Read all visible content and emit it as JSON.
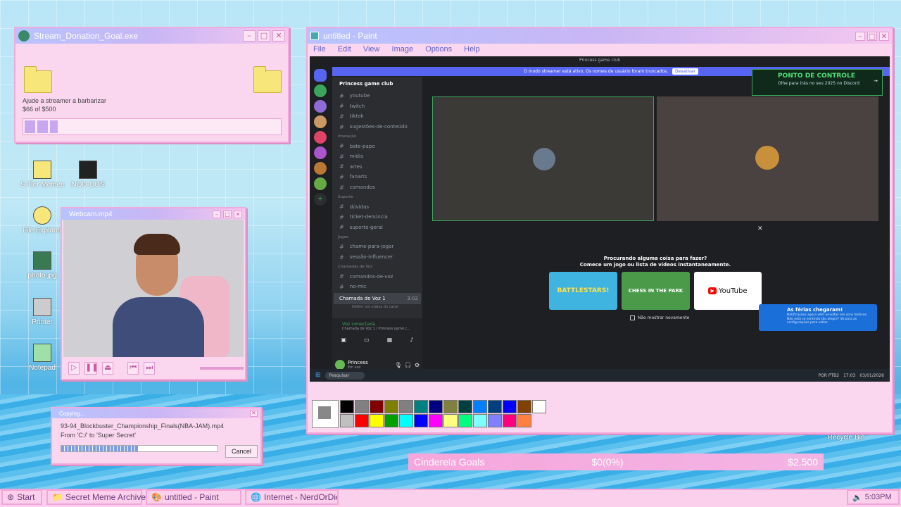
{
  "donation": {
    "title": "Stream_Donation_Goal.exe",
    "text": "Ajude a streamer a barbarizar",
    "amount": "$66 of $500",
    "progress": 0.13
  },
  "desktop_icons": [
    {
      "label": "S-Tier Memes"
    },
    {
      "label": "NOD-DOS"
    },
    {
      "label": "File Explorer"
    },
    {
      "label": "photo.jpg"
    },
    {
      "label": "Printer"
    },
    {
      "label": "Notepad"
    },
    {
      "label": "Recycle Bin"
    }
  ],
  "webcam": {
    "title": "Webcam.mp4"
  },
  "copying": {
    "title": "Copying...",
    "file": "93-94_Blockbuster_Championship_Finals(NBA-JAM).mp4",
    "path": "From 'C:/' to 'Super Secret'",
    "cancel": "Cancel",
    "progress": 0.49
  },
  "paint": {
    "title": "untitled - Paint",
    "menu": [
      "File",
      "Edit",
      "View",
      "Image",
      "Options",
      "Help"
    ],
    "palette": [
      "#000000",
      "#808080",
      "#800000",
      "#808000",
      "#808080",
      "#008080",
      "#000080",
      "#808040",
      "#004040",
      "#0080ff",
      "#004080",
      "#0000ff",
      "#804000",
      "#ffffff",
      "#c0c0c0",
      "#ff0000",
      "#ffff00",
      "#00a000",
      "#00ffff",
      "#0000ff",
      "#ff00ff",
      "#ffff80",
      "#00ff80",
      "#80ffff",
      "#8080ff",
      "#ff0080",
      "#ff8040"
    ]
  },
  "discord": {
    "window_title": "Princess game club",
    "banner": "O modo streamer está ativo. Os nomes de usuário foram truncados.",
    "banner_button": "Desativar",
    "server": "Princess game club",
    "channels_top": [
      "youtube",
      "twitch",
      "tiktok",
      "sugestões-de-conteúdo"
    ],
    "cat_interacao": "Interação",
    "channels_interacao": [
      "bate-papo",
      "mídia",
      "artes",
      "fanarts",
      "comandos"
    ],
    "cat_suporte": "Suporte",
    "channels_suporte": [
      "dúvidas",
      "ticket-denúncia",
      "suporte-geral"
    ],
    "cat_jogos": "Jogos",
    "channels_jogos": [
      "chame-para-jogar",
      "sessão-influencer"
    ],
    "cat_voz": "Chamadas de Voz",
    "channels_voz": [
      "comandos-de-voz",
      "no-mic"
    ],
    "voice_active": "Chamada de Voz 1",
    "voice_time": "3:02",
    "voice_status_sub": "Definir um status do canal",
    "voice_connected": "Voz conectada",
    "voice_connected_sub": "Chamada de Voz 1 / Princess game c...",
    "user": "Princess",
    "user_status": "Em voz",
    "activity_title": "Procurando alguma coisa para fazer?",
    "activity_sub": "Comece um jogo ou lista de vídeos instantaneamente.",
    "activities": [
      "BATTLESTARS!",
      "CHESS IN THE PARK",
      "YouTube"
    ],
    "no_show": "Não mostrar novamente",
    "promo_title": "PONTO DE CONTROLE",
    "promo_sub": "Olhe para trás no seu 2025 no Discord",
    "notice_title": "As férias chegaram!",
    "notice_body": "Notificações agora vêm envoltas em sons festivos. Não está se sentindo tão alegre? Vá para as configurações para voltar.",
    "search": "Pesquisar",
    "tray_lang": "POR PTB2",
    "tray_time": "17:03",
    "tray_date": "03/01/2026"
  },
  "goal_bar": {
    "name": "Cinderela Goals",
    "current": "$0(0%)",
    "target": "$2.500"
  },
  "taskbar": {
    "start": "Start",
    "items": [
      "Secret Meme Archive",
      "untitled - Paint",
      "Internet - NerdOrDie.com"
    ],
    "clock": "5:03PM"
  }
}
